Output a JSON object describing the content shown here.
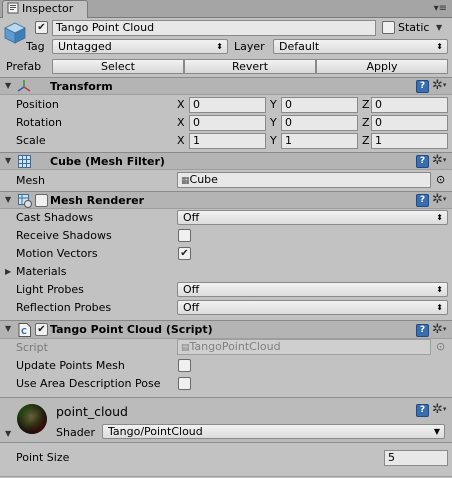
{
  "tab": {
    "title": "Inspector"
  },
  "gameobject": {
    "active_checked": true,
    "name": "Tango Point Cloud",
    "static_label": "Static",
    "tag_label": "Tag",
    "tag_value": "Untagged",
    "layer_label": "Layer",
    "layer_value": "Default",
    "prefab_label": "Prefab",
    "prefab_buttons": [
      "Select",
      "Revert",
      "Apply"
    ]
  },
  "transform": {
    "title": "Transform",
    "rows": [
      {
        "label": "Position",
        "x": "0",
        "y": "0",
        "z": "0"
      },
      {
        "label": "Rotation",
        "x": "0",
        "y": "0",
        "z": "0"
      },
      {
        "label": "Scale",
        "x": "1",
        "y": "1",
        "z": "1"
      }
    ],
    "axis_labels": [
      "X",
      "Y",
      "Z"
    ]
  },
  "mesh_filter": {
    "title": "Cube (Mesh Filter)",
    "mesh_label": "Mesh",
    "mesh_value": "Cube"
  },
  "mesh_renderer": {
    "title": "Mesh Renderer",
    "cast_shadows_label": "Cast Shadows",
    "cast_shadows_value": "Off",
    "receive_shadows_label": "Receive Shadows",
    "receive_shadows_checked": false,
    "motion_vectors_label": "Motion Vectors",
    "motion_vectors_checked": true,
    "materials_label": "Materials",
    "light_probes_label": "Light Probes",
    "light_probes_value": "Off",
    "reflection_probes_label": "Reflection Probes",
    "reflection_probes_value": "Off"
  },
  "script": {
    "title": "Tango Point Cloud (Script)",
    "script_label": "Script",
    "script_value": "TangoPointCloud",
    "update_points_label": "Update Points Mesh",
    "update_points_checked": false,
    "use_area_label": "Use Area Description Pose",
    "use_area_checked": false
  },
  "material": {
    "name": "point_cloud",
    "shader_label": "Shader",
    "shader_value": "Tango/PointCloud",
    "point_size_label": "Point Size",
    "point_size_value": "5"
  },
  "colors": {
    "panel": "#c2c2c2",
    "header": "#b4b4b4",
    "field": "#e8e8e8",
    "help_icon": "#3a6eb3"
  },
  "icons": {
    "tab": "inspector-icon",
    "gameobject": "cube-icon",
    "transform": "transform-axes-icon",
    "mesh_filter": "mesh-grid-icon",
    "mesh_renderer": "mesh-renderer-icon",
    "script": "csharp-script-icon",
    "material": "material-sphere-icon",
    "help": "help-book-icon",
    "settings": "gear-icon"
  }
}
